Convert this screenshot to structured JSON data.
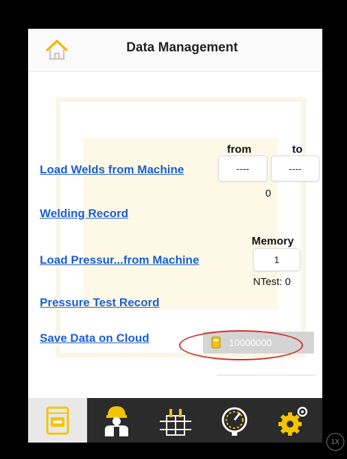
{
  "header": {
    "title": "Data Management",
    "home_icon": "home-icon"
  },
  "colors": {
    "link": "#1a5fd0",
    "tabbar": "#2b2b2b",
    "tab_active": "#e8e8e8",
    "accent_yellow": "#f5c400",
    "annotation_red": "#d42a2a"
  },
  "load_welds": {
    "link": "Load Welds from Machine",
    "from_label": "from",
    "to_label": "to",
    "from_value": "----",
    "to_value": "----",
    "count": "0"
  },
  "welding_record": {
    "link": "Welding Record"
  },
  "load_pressure": {
    "link": "Load Pressur...from Machine",
    "memory_label": "Memory",
    "memory_value": "1",
    "ntest": "NTest: 0"
  },
  "pressure_record": {
    "link": "Pressure Test Record"
  },
  "cloud": {
    "link": "Save Data on Cloud",
    "value": "10000000"
  },
  "tabs": [
    {
      "icon": "machine-data-icon",
      "active": true
    },
    {
      "icon": "welder-worker-icon",
      "active": false
    },
    {
      "icon": "pipe-fitting-icon",
      "active": false
    },
    {
      "icon": "pressure-gauge-icon",
      "active": false
    },
    {
      "icon": "settings-gear-icon",
      "active": false
    }
  ],
  "zoom_badge": "1X"
}
